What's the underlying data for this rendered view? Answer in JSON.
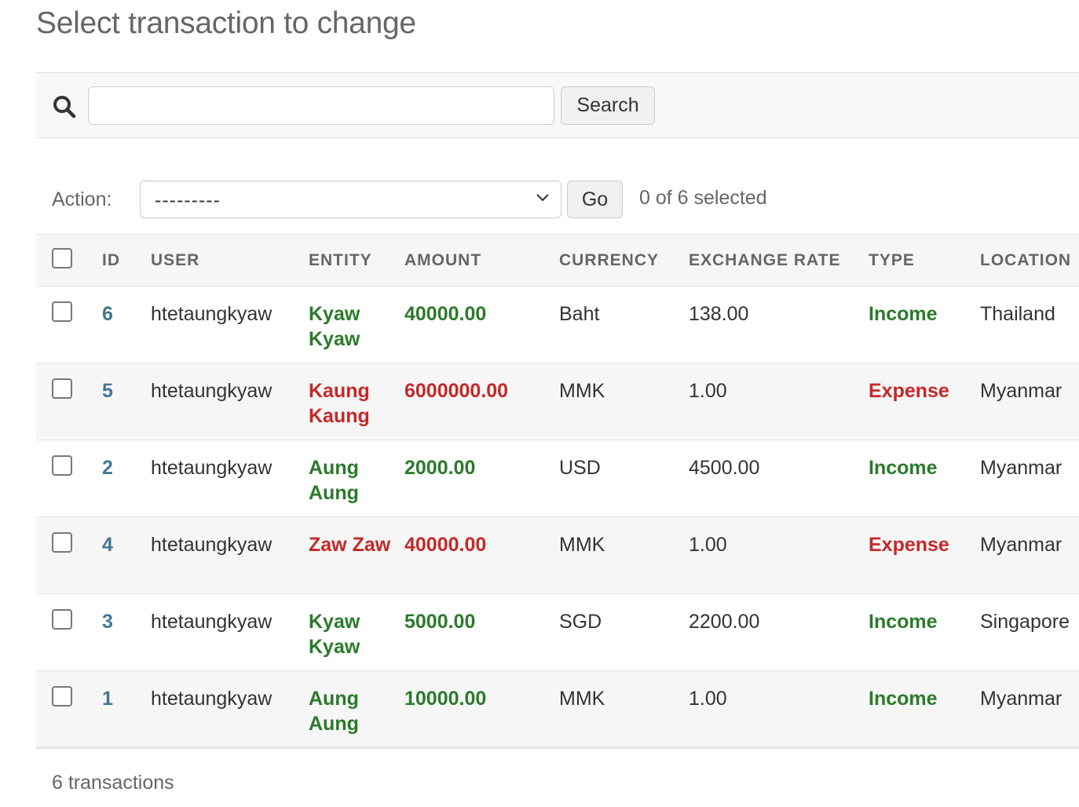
{
  "page": {
    "title": "Select transaction to change"
  },
  "search": {
    "value": "",
    "button_label": "Search"
  },
  "actions": {
    "label": "Action:",
    "selected_option": "---------",
    "go_label": "Go",
    "selection_counter": "0 of 6 selected"
  },
  "colors": {
    "income": "#2b7a2b",
    "expense": "#c62828",
    "link": "#417893"
  },
  "table": {
    "columns": [
      "ID",
      "USER",
      "ENTITY",
      "AMOUNT",
      "CURRENCY",
      "EXCHANGE RATE",
      "TYPE",
      "LOCATION"
    ],
    "rows": [
      {
        "id": "6",
        "user": "htetaungkyaw",
        "entity": "Kyaw Kyaw",
        "amount": "40000.00",
        "currency": "Baht",
        "exchange_rate": "138.00",
        "type": "Income",
        "location": "Thailand"
      },
      {
        "id": "5",
        "user": "htetaungkyaw",
        "entity": "Kaung Kaung",
        "amount": "6000000.00",
        "currency": "MMK",
        "exchange_rate": "1.00",
        "type": "Expense",
        "location": "Myanmar"
      },
      {
        "id": "2",
        "user": "htetaungkyaw",
        "entity": "Aung Aung",
        "amount": "2000.00",
        "currency": "USD",
        "exchange_rate": "4500.00",
        "type": "Income",
        "location": "Myanmar"
      },
      {
        "id": "4",
        "user": "htetaungkyaw",
        "entity": "Zaw Zaw",
        "amount": "40000.00",
        "currency": "MMK",
        "exchange_rate": "1.00",
        "type": "Expense",
        "location": "Myanmar"
      },
      {
        "id": "3",
        "user": "htetaungkyaw",
        "entity": "Kyaw Kyaw",
        "amount": "5000.00",
        "currency": "SGD",
        "exchange_rate": "2200.00",
        "type": "Income",
        "location": "Singapore"
      },
      {
        "id": "1",
        "user": "htetaungkyaw",
        "entity": "Aung Aung",
        "amount": "10000.00",
        "currency": "MMK",
        "exchange_rate": "1.00",
        "type": "Income",
        "location": "Myanmar"
      }
    ]
  },
  "paginator": {
    "text": "6 transactions"
  }
}
